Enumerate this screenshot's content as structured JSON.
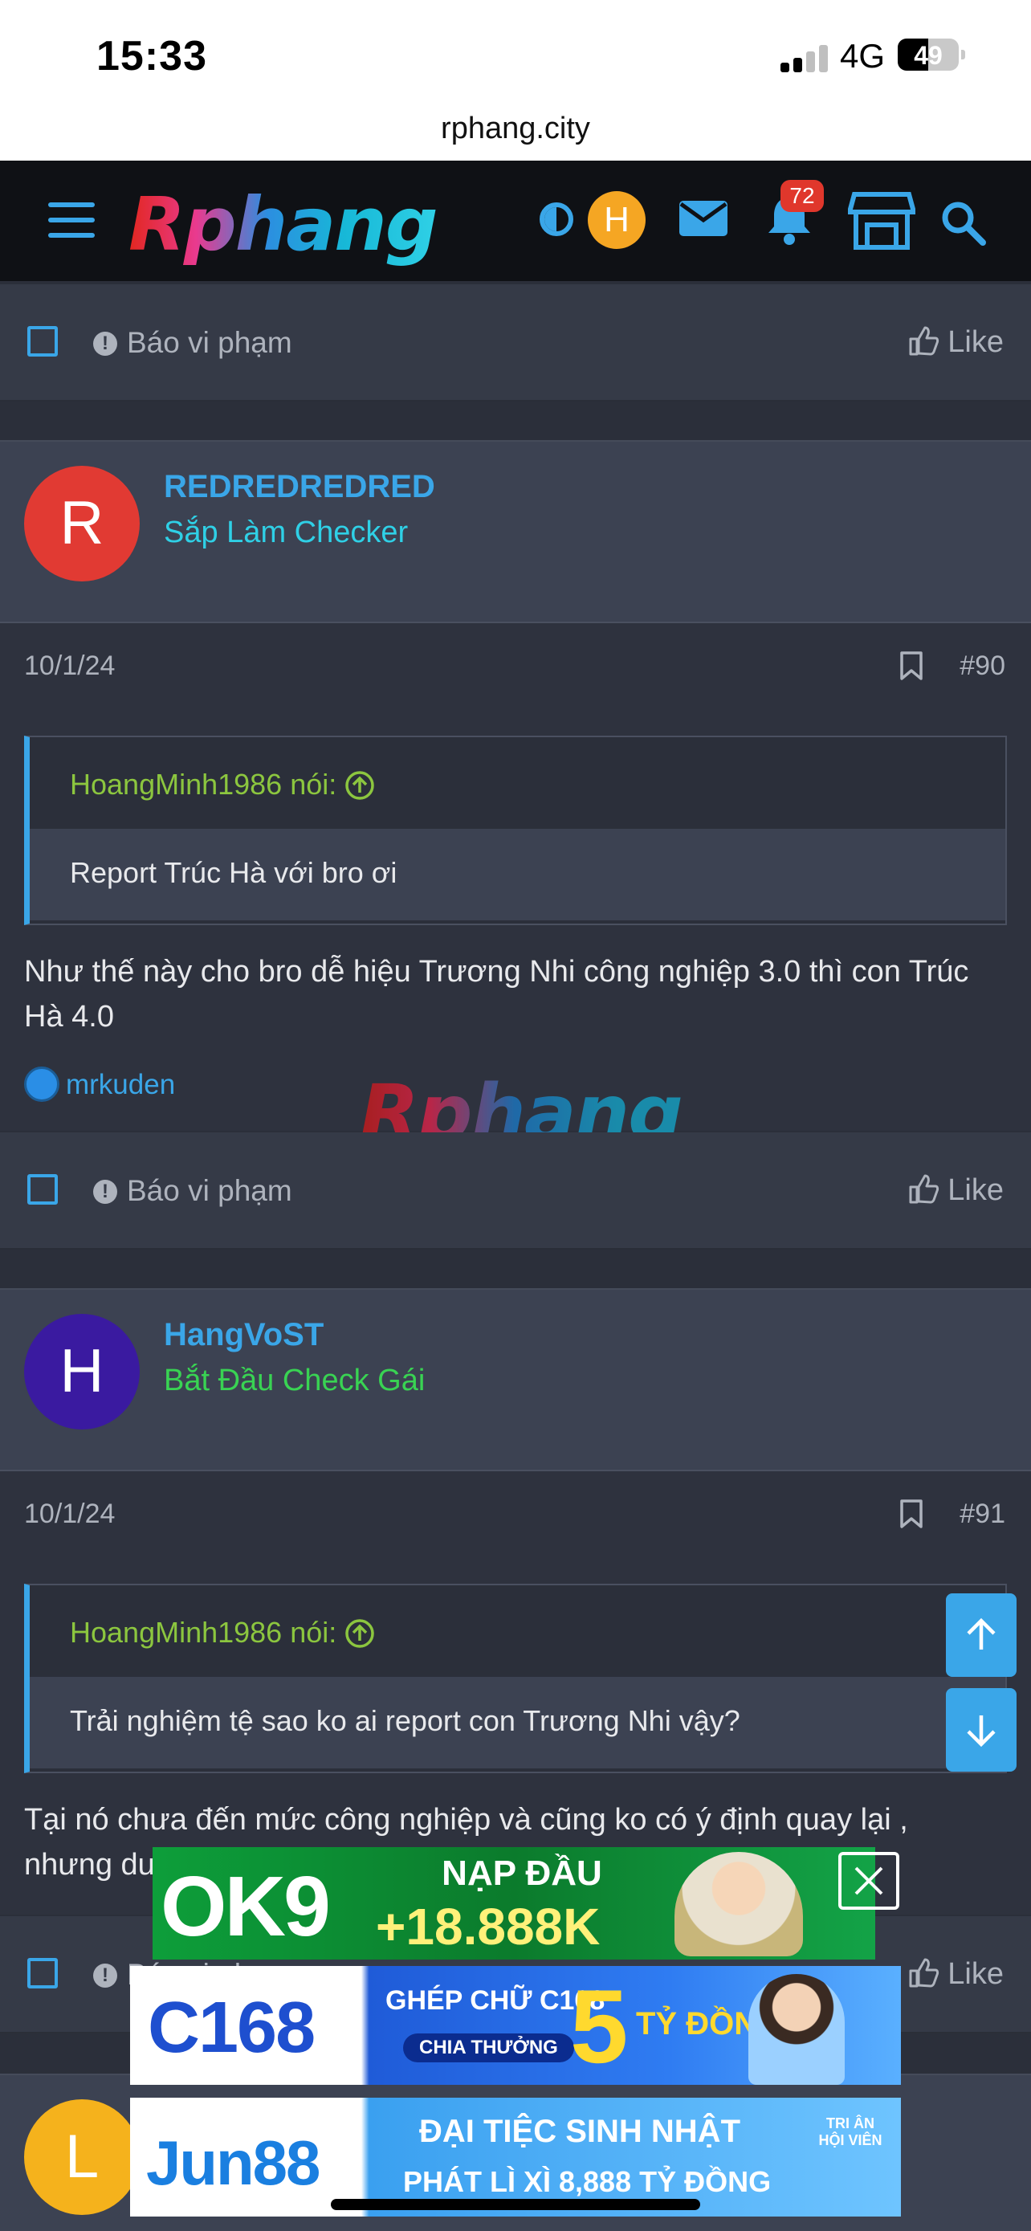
{
  "status": {
    "time": "15:33",
    "network": "4G",
    "battery": "49"
  },
  "browser": {
    "url": "rphang.city"
  },
  "nav": {
    "logo": "Rphang",
    "avatar_letter": "H",
    "notifications_count": "72"
  },
  "footer": {
    "report_label": "Báo vi phạm",
    "like_label": "Like"
  },
  "posts": [
    {
      "avatar_letter": "R",
      "avatar_color": "#e13a33",
      "username": "REDREDREDRED",
      "user_title": "Sắp Làm Checker",
      "user_title_color": "#2fd0e6",
      "date": "10/1/24",
      "number": "#90",
      "quote_author": "HoangMinh1986 nói:",
      "quote_text": "Report Trúc Hà với bro ơi",
      "message": "Như thế này cho bro dễ hiệu Trương Nhi công nghiệp 3.0 thì con Trúc Hà 4.0",
      "reaction_user": "mrkuden"
    },
    {
      "avatar_letter": "H",
      "avatar_color": "#3a1aa0",
      "username": "HangVoST",
      "user_title": "Bắt Đầu Check Gái",
      "user_title_color": "#39d353",
      "date": "10/1/24",
      "number": "#91",
      "quote_author": "HoangMinh1986 nói:",
      "quote_text": "Trải nghiệm tệ sao ko ai report con Trương Nhi vậy?",
      "message_line1": "Tại nó chưa đến mức công nghiệp và cũng ko có ý định quay lại ,",
      "message_line2": "nhưng du"
    },
    {
      "avatar_letter": "L",
      "avatar_color": "#f5b21c"
    }
  ],
  "watermark": "Rphang",
  "ads": {
    "ok9": {
      "brand": "OK9",
      "line1": "NẠP ĐẦU",
      "line2": "+18.888K"
    },
    "c168": {
      "brand": "C168",
      "line1": "GHÉP CHỮ C168",
      "line2": "CHIA THƯỞNG",
      "line3": "5",
      "line4": "TỶ ĐỒNG"
    },
    "jun88": {
      "brand": "Jun88",
      "line1": "ĐẠI TIỆC SINH NHẬT",
      "line2": "PHÁT LÌ XÌ 8,888 TỶ ĐỒNG",
      "badge": "TRI ÂN HỘI VIÊN"
    }
  },
  "colors": {
    "accent": "#3aa6e8",
    "background": "#2b2f3a",
    "quote_author": "#8cc63f"
  }
}
